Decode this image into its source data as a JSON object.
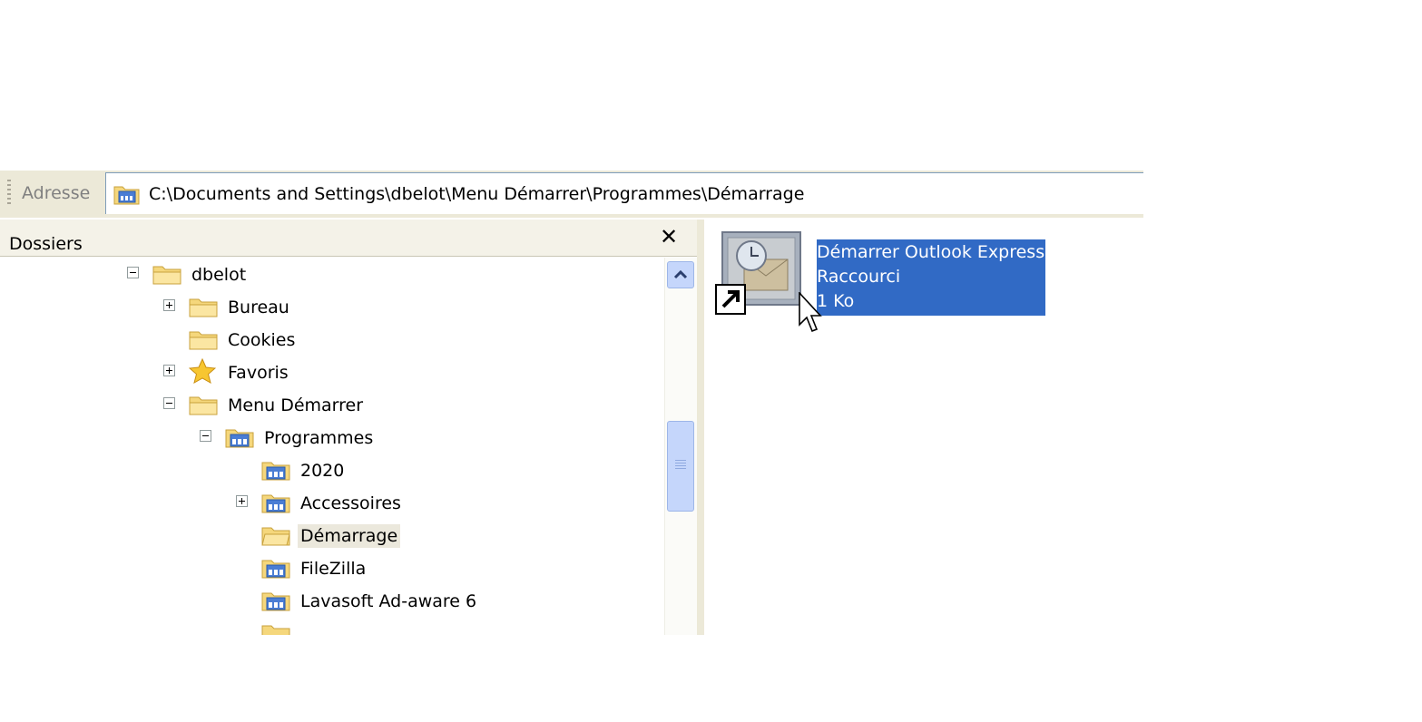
{
  "address_bar": {
    "label": "Adresse",
    "path": "C:\\Documents and Settings\\dbelot\\Menu Démarrer\\Programmes\\Démarrage"
  },
  "folders_pane": {
    "title": "Dossiers",
    "close_glyph": "✕",
    "tree": [
      {
        "label": "dbelot",
        "icon": "folder-icon",
        "expander": "minus"
      },
      {
        "label": "Bureau",
        "icon": "folder-icon",
        "expander": "plus"
      },
      {
        "label": "Cookies",
        "icon": "folder-icon",
        "expander": "none"
      },
      {
        "label": "Favoris",
        "icon": "star-icon",
        "expander": "plus"
      },
      {
        "label": "Menu Démarrer",
        "icon": "folder-icon",
        "expander": "minus"
      },
      {
        "label": "Programmes",
        "icon": "program-folder-icon",
        "expander": "minus"
      },
      {
        "label": "2020",
        "icon": "program-folder-icon",
        "expander": "none"
      },
      {
        "label": "Accessoires",
        "icon": "program-folder-icon",
        "expander": "plus"
      },
      {
        "label": "Démarrage",
        "icon": "folder-icon",
        "expander": "none",
        "selected": true
      },
      {
        "label": "FileZilla",
        "icon": "program-folder-icon",
        "expander": "none"
      },
      {
        "label": "Lavasoft Ad-aware 6",
        "icon": "program-folder-icon",
        "expander": "none"
      }
    ]
  },
  "content": {
    "file": {
      "name": "Démarrer Outlook Express",
      "type": "Raccourci",
      "size": "1 Ko",
      "icon": "outlook-express-shortcut-icon"
    }
  },
  "colors": {
    "selection": "#316ac5",
    "toolbar": "#ece9d8",
    "folder": "#f5d77c",
    "scrollbar": "#c5d6fb"
  }
}
